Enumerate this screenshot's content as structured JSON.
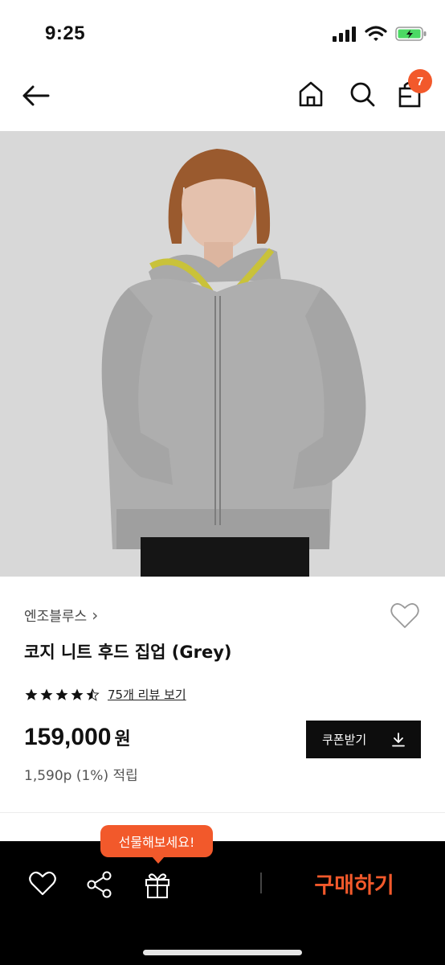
{
  "status_bar": {
    "time": "9:25"
  },
  "nav": {
    "cart_count": "7"
  },
  "product": {
    "brand": "엔조블루스",
    "brand_chevron": "›",
    "title": "코지 니트 후드 집업 (Grey)",
    "rating": 4.5,
    "review_link": "75개 리뷰 보기",
    "price": "159,000",
    "currency": "원",
    "points": "1,590p (1%) 적립"
  },
  "coupon_button": {
    "label": "쿠폰받기"
  },
  "bottom_bar": {
    "gift_tooltip": "선물해보세요!",
    "buy_label": "구매하기"
  },
  "colors": {
    "accent": "#f2592b",
    "dark": "#0d0d0d",
    "battery": "#4cd964"
  },
  "icons": [
    "back-arrow-icon",
    "home-icon",
    "search-icon",
    "shopping-bag-icon",
    "heart-icon",
    "share-icon",
    "gift-icon",
    "download-icon",
    "star-icon",
    "signal-icon",
    "wifi-icon",
    "battery-icon"
  ]
}
